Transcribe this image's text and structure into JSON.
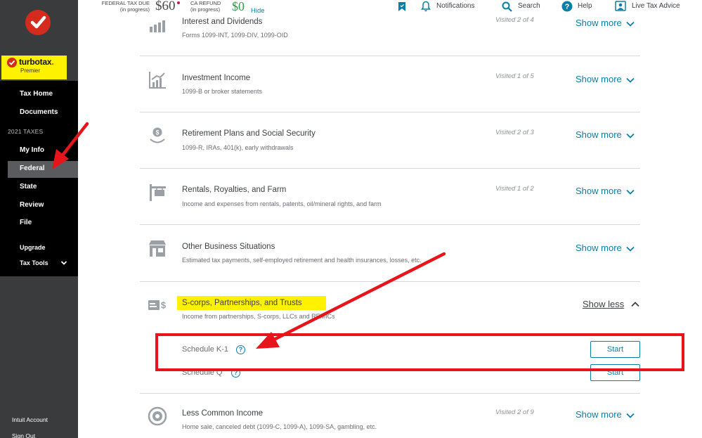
{
  "sidebar": {
    "brand": {
      "name": "turbotax",
      "edition": "Premier"
    },
    "nav_top": [
      {
        "label": "Tax Home"
      },
      {
        "label": "Documents"
      }
    ],
    "section_label": "2021 TAXES",
    "nav_taxes": [
      {
        "label": "My Info"
      },
      {
        "label": "Federal"
      },
      {
        "label": "State"
      },
      {
        "label": "Review"
      },
      {
        "label": "File"
      }
    ],
    "nav_extra": [
      {
        "label": "Upgrade"
      },
      {
        "label": "Tax Tools"
      }
    ],
    "nav_bottom": [
      {
        "label": "Intuit Account"
      },
      {
        "label": "Sign Out"
      }
    ],
    "active_item": "Federal"
  },
  "topbar": {
    "federal_label": "FEDERAL TAX DUE",
    "federal_status": "(in progress)",
    "federal_value": "$60",
    "ca_label": "CA REFUND",
    "ca_status": "(in progress)",
    "ca_value": "$0",
    "hide_label": "Hide",
    "items": [
      {
        "label": "Notifications",
        "icon": "bell-icon"
      },
      {
        "label": "Search",
        "icon": "search-icon"
      },
      {
        "label": "Help",
        "icon": "help-icon"
      },
      {
        "label": "Live Tax Advice",
        "icon": "live-advice-icon"
      }
    ],
    "bookmark_icon": "bookmark-icon"
  },
  "sections": [
    {
      "title": "Interest and Dividends",
      "subtitle": "Forms 1099-INT, 1099-DIV, 1099-OID",
      "visited": "Visited 2 of 4",
      "toggle": "Show more",
      "icon": "bar-chart-icon"
    },
    {
      "title": "Investment Income",
      "subtitle": "1099-B or broker statements",
      "visited": "Visited 1 of 5",
      "toggle": "Show more",
      "icon": "investment-chart-icon"
    },
    {
      "title": "Retirement Plans and Social Security",
      "subtitle": "1099-R, IRAs, 401(k), early withdrawals",
      "visited": "Visited 2 of 3",
      "toggle": "Show more",
      "icon": "nest-egg-icon"
    },
    {
      "title": "Rentals, Royalties, and Farm",
      "subtitle": "Income and expenses from rentals, patents, oil/mineral rights, and farm",
      "visited": "Visited 1 of 2",
      "toggle": "Show more",
      "icon": "rental-sign-icon"
    },
    {
      "title": "Other Business Situations",
      "subtitle": "Estimated tax payments, self-employed retirement and health insurances, losses, etc.",
      "visited": "",
      "toggle": "Show more",
      "icon": "storefront-icon"
    },
    {
      "title": "S-corps, Partnerships, and Trusts",
      "subtitle": "Income from partnerships, S-corps, LLCs and REMICs",
      "visited": "",
      "toggle": "Show less",
      "icon": "money-card-icon",
      "rows": [
        {
          "label": "Schedule K-1",
          "button": "Start"
        },
        {
          "label": "Schedule Q",
          "button": "Start"
        }
      ]
    },
    {
      "title": "Less Common Income",
      "subtitle": "Home sale, canceled debt (1099-C, 1099-A), 1099-SA, gambling, etc.",
      "visited": "Visited 2 of 9",
      "toggle": "Show more",
      "icon": "coin-stack-icon"
    }
  ],
  "colors": {
    "accent": "#0a7ea7",
    "annotation_red": "#e8141b",
    "highlight": "#fff200",
    "sidebar": "#3a3b3d"
  }
}
